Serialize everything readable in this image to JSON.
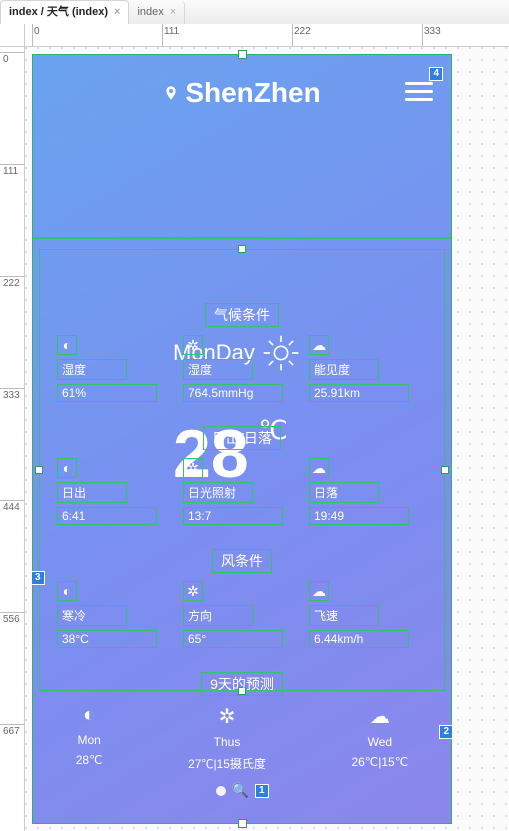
{
  "editor": {
    "tabs": [
      {
        "label": "index / 天气 (index)",
        "active": true
      },
      {
        "label": "index",
        "active": false
      }
    ],
    "hticks": [
      "0",
      "111",
      "222",
      "333"
    ],
    "vticks": [
      "0",
      "111",
      "222",
      "333",
      "444",
      "556",
      "667"
    ]
  },
  "badges": {
    "menu": "4",
    "leftMarker": "3",
    "rightMarker": "2",
    "pager": "1"
  },
  "weather": {
    "city": "ShenZhen",
    "day": "MonDay",
    "temp": "28",
    "unit": "℃",
    "climate": {
      "title": "气候条件",
      "items": [
        {
          "icon": "◐",
          "label": "湿度",
          "value": "61%"
        },
        {
          "icon": "✲",
          "label": "湿度",
          "value": "764.5mmHg"
        },
        {
          "icon": "☁",
          "label": "能见度",
          "value": "25.91km"
        }
      ]
    },
    "sun": {
      "title": "日出/日落",
      "items": [
        {
          "icon": "◐",
          "label": "日出",
          "value": "6:41"
        },
        {
          "icon": "✲",
          "label": "日光照射",
          "value": "13:7"
        },
        {
          "icon": "☁",
          "label": "日落",
          "value": "19:49"
        }
      ]
    },
    "wind": {
      "title": "风条件",
      "items": [
        {
          "icon": "◐",
          "label": "寒冷",
          "value": "38°C"
        },
        {
          "icon": "✲",
          "label": "方向",
          "value": "65°"
        },
        {
          "icon": "☁",
          "label": "飞速",
          "value": "6.44km/h"
        }
      ]
    },
    "forecast": {
      "title": "9天的预测",
      "days": [
        {
          "icon": "◐",
          "name": "Mon",
          "t": "28℃"
        },
        {
          "icon": "✲",
          "name": "Thus",
          "t": "27℃|15摄氏度"
        },
        {
          "icon": "☁",
          "name": "Wed",
          "t": "26℃|15℃"
        }
      ]
    }
  }
}
